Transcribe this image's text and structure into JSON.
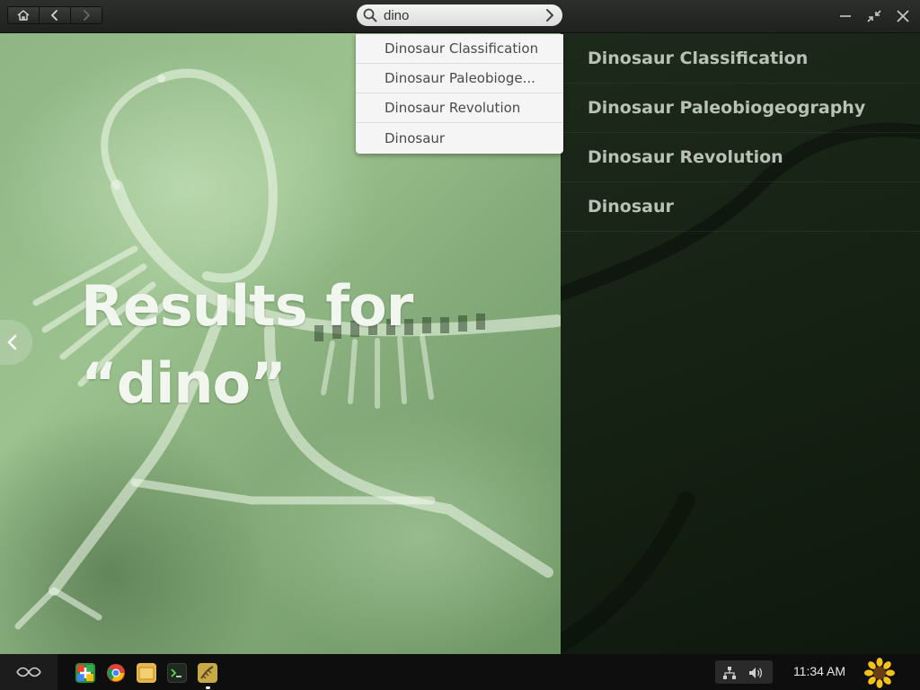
{
  "header": {
    "search": {
      "value": "dino",
      "placeholder": ""
    }
  },
  "page": {
    "title_line1": "Results for",
    "title_line2": "“dino”"
  },
  "autocomplete": {
    "items": [
      {
        "label": "Dinosaur Classification"
      },
      {
        "label": "Dinosaur Paleobioge..."
      },
      {
        "label": "Dinosaur Revolution"
      },
      {
        "label": "Dinosaur"
      }
    ]
  },
  "results": {
    "items": [
      {
        "label": "Dinosaur Classification"
      },
      {
        "label": "Dinosaur Paleobiogeography"
      },
      {
        "label": "Dinosaur Revolution"
      },
      {
        "label": "Dinosaur"
      }
    ]
  },
  "taskbar": {
    "apps": [
      {
        "icon": "app-store-icon",
        "color": "#2b8f3a"
      },
      {
        "icon": "chrome-icon",
        "color": "#db4437"
      },
      {
        "icon": "files-icon",
        "color": "#e8b64a"
      },
      {
        "icon": "terminal-icon",
        "color": "#1e2a1e"
      },
      {
        "icon": "encyclopedia-icon",
        "color": "#c9a847"
      }
    ],
    "clock": "11:34 AM"
  },
  "colors": {
    "accent_green": "#9cc28f",
    "dark_panel": "#142012",
    "dropdown_bg": "#f5f5f5"
  }
}
